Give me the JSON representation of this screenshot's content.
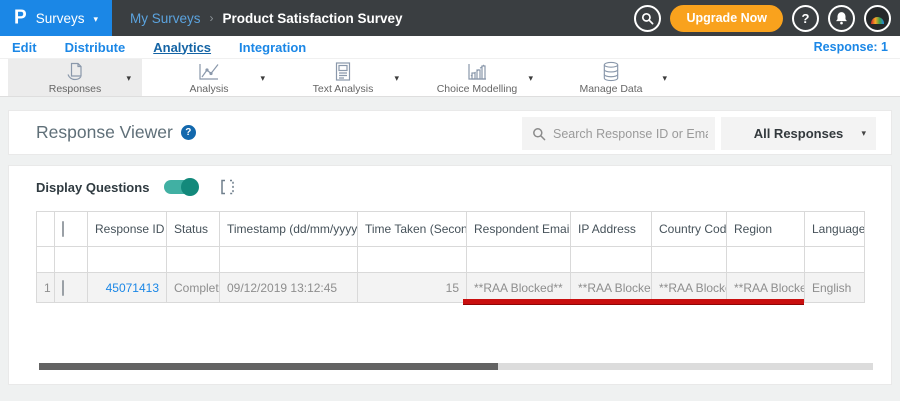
{
  "topbar": {
    "logo_letter": "P",
    "product_menu": "Surveys",
    "menu_caret": "▾",
    "breadcrumb": {
      "parent": "My Surveys",
      "separator": "›",
      "current": "Product Satisfaction Survey"
    },
    "upgrade_button": "Upgrade Now",
    "help_glyph": "?"
  },
  "nav": {
    "items": [
      {
        "label": "Edit"
      },
      {
        "label": "Distribute"
      },
      {
        "label": "Analytics"
      },
      {
        "label": "Integration"
      }
    ],
    "response_count": "Response: 1"
  },
  "toolbar": {
    "caret": "▾",
    "items": [
      {
        "label": "Responses"
      },
      {
        "label": "Analysis"
      },
      {
        "label": "Text Analysis"
      },
      {
        "label": "Choice Modelling"
      },
      {
        "label": "Manage Data"
      }
    ]
  },
  "viewer": {
    "title": "Response Viewer",
    "help_glyph": "?",
    "search_placeholder": "Search Response ID or Email",
    "filter_value": "All Responses",
    "dropdown_caret": "▾"
  },
  "controls": {
    "display_questions": "Display Questions"
  },
  "table": {
    "columns": [
      {
        "label": "Response ID",
        "sort": "▼"
      },
      {
        "label": "Status",
        "sort": ""
      },
      {
        "label": "Timestamp (dd/mm/yyyy)",
        "sort": "⇅"
      },
      {
        "label": "Time Taken (Seconds)",
        "sort": "⇅"
      },
      {
        "label": "Respondent Email",
        "sort": ""
      },
      {
        "label": "IP Address",
        "sort": ""
      },
      {
        "label": "Country Code",
        "sort": ""
      },
      {
        "label": "Region",
        "sort": ""
      },
      {
        "label": "Language",
        "sort": ""
      }
    ],
    "rows": [
      {
        "index": "1",
        "response_id": "45071413",
        "status": "Completed",
        "timestamp": "09/12/2019 13:12:45",
        "time_taken": "15",
        "respondent_email": "**RAA Blocked**",
        "ip_address": "**RAA Blocked**",
        "country_code": "**RAA Blocked**",
        "region": "**RAA Blocked**",
        "language": "English"
      }
    ]
  },
  "colors": {
    "accent_blue": "#1b87e6",
    "upgrade_orange": "#f9a21d",
    "toggle_teal": "#2fa89b",
    "annotation_red": "#c90f0f"
  }
}
